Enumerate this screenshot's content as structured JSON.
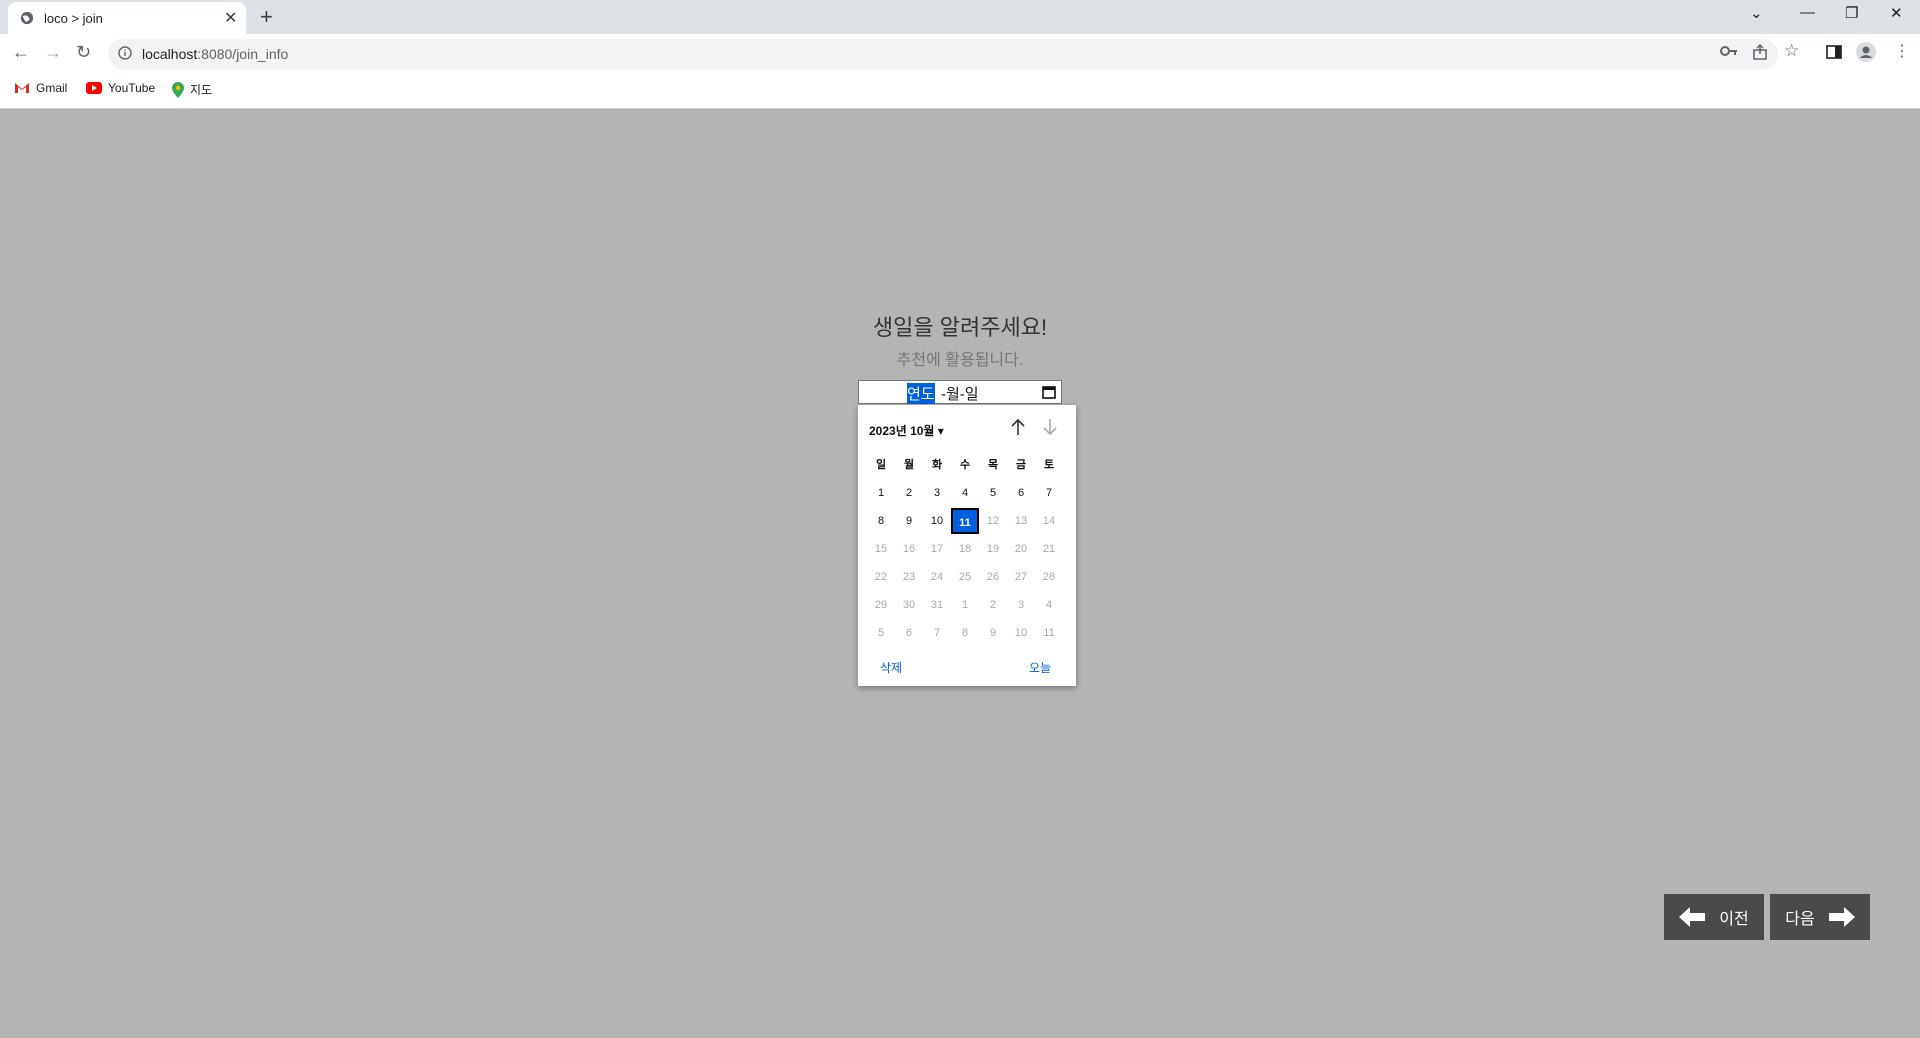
{
  "browser": {
    "tab_title": "loco > join",
    "url_host": "localhost",
    "url_rest": ":8080/join_info",
    "bookmarks": [
      {
        "label": "Gmail",
        "icon": "gmail-icon"
      },
      {
        "label": "YouTube",
        "icon": "youtube-icon"
      },
      {
        "label": "지도",
        "icon": "maps-icon"
      }
    ]
  },
  "page": {
    "heading": "생일을 알려주세요!",
    "subheading": "추천에 활용됩니다.",
    "date_input": {
      "year_placeholder": "연도",
      "rest_placeholder": "-월-일"
    },
    "prev_label": "이전",
    "next_label": "다음"
  },
  "picker": {
    "month_label": "2023년 10월",
    "weekdays": [
      "일",
      "월",
      "화",
      "수",
      "목",
      "금",
      "토"
    ],
    "weeks": [
      [
        "1",
        "2",
        "3",
        "4",
        "5",
        "6",
        "7"
      ],
      [
        "8",
        "9",
        "10",
        "11",
        "12",
        "13",
        "14"
      ],
      [
        "15",
        "16",
        "17",
        "18",
        "19",
        "20",
        "21"
      ],
      [
        "22",
        "23",
        "24",
        "25",
        "26",
        "27",
        "28"
      ],
      [
        "29",
        "30",
        "31",
        "1",
        "2",
        "3",
        "4"
      ],
      [
        "5",
        "6",
        "7",
        "8",
        "9",
        "10",
        "11"
      ]
    ],
    "today": "11",
    "clear_label": "삭제",
    "today_label": "오늘"
  },
  "colors": {
    "accent": "#0060df",
    "page_bg": "#b4b4b4",
    "button_bg": "#4a4a4a"
  }
}
